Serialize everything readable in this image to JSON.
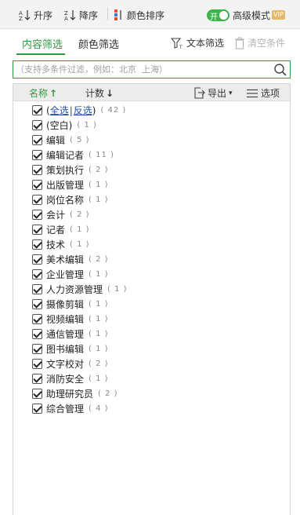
{
  "toolbar": {
    "sort_asc": "升序",
    "sort_desc": "降序",
    "color_sort": "颜色排序",
    "toggle_text": "开",
    "advanced_mode": "高级模式",
    "vip_badge": "VIP"
  },
  "tabs": {
    "content_filter": "内容筛选",
    "color_filter": "颜色筛选",
    "text_filter": "文本筛选",
    "clear_conditions": "清空条件"
  },
  "search": {
    "placeholder": "（支持多条件过滤，例如：北京  上海）"
  },
  "list_header": {
    "name_sort": "名称",
    "count_sort": "计数",
    "export": "导出",
    "options": "选项"
  },
  "select_all": {
    "open_paren": "(",
    "all": "全选",
    "sep": "|",
    "invert": "反选",
    "close_paren": ")",
    "count": "( 42 )"
  },
  "items": [
    {
      "label": "(空白)",
      "count": "( 1 )"
    },
    {
      "label": "编辑",
      "count": "( 5 )"
    },
    {
      "label": "编辑记者",
      "count": "( 11 )"
    },
    {
      "label": "策划执行",
      "count": "( 2 )"
    },
    {
      "label": "出版管理",
      "count": "( 1 )"
    },
    {
      "label": "岗位名称",
      "count": "( 1 )"
    },
    {
      "label": "会计",
      "count": "( 2 )"
    },
    {
      "label": "记者",
      "count": "( 1 )"
    },
    {
      "label": "技术",
      "count": "( 1 )"
    },
    {
      "label": "美术编辑",
      "count": "( 2 )"
    },
    {
      "label": "企业管理",
      "count": "( 1 )"
    },
    {
      "label": "人力资源管理",
      "count": "( 1 )"
    },
    {
      "label": "摄像剪辑",
      "count": "( 1 )"
    },
    {
      "label": "视频编辑",
      "count": "( 1 )"
    },
    {
      "label": "通信管理",
      "count": "( 1 )"
    },
    {
      "label": "图书编辑",
      "count": "( 1 )"
    },
    {
      "label": "文字校对",
      "count": "( 2 )"
    },
    {
      "label": "消防安全",
      "count": "( 1 )"
    },
    {
      "label": "助理研究员",
      "count": "( 2 )"
    },
    {
      "label": "综合管理",
      "count": "( 4 )"
    }
  ],
  "colors": {
    "accent": "#2f9a3e",
    "link": "#1f4ea8",
    "toggle_on": "#3bb54a",
    "vip": "#e7b869"
  }
}
